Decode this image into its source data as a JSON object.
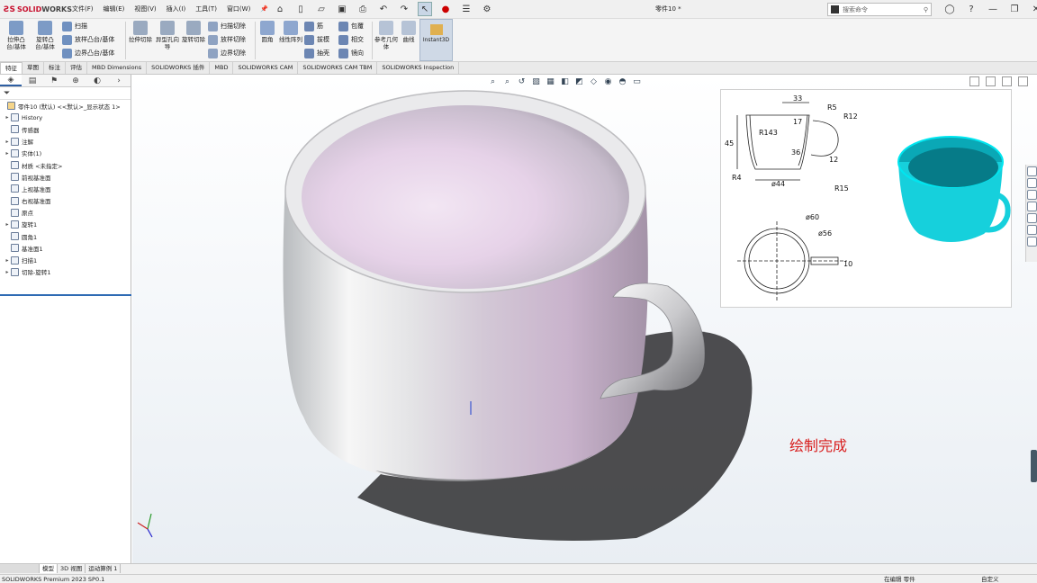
{
  "app": {
    "brand_prefix": "SOLID",
    "brand_suffix": "WORKS",
    "document_title": "零件10 *"
  },
  "menu": [
    "文件(F)",
    "编辑(E)",
    "视图(V)",
    "插入(I)",
    "工具(T)",
    "窗口(W)"
  ],
  "search": {
    "placeholder": "搜索命令"
  },
  "ribbon": {
    "big": [
      "拉伸凸台/基体",
      "旋转凸台/基体",
      "拉伸切除",
      "异型孔向导",
      "旋转切除",
      "圆角",
      "线性阵列",
      "参考几何体",
      "曲线",
      "Instant3D"
    ],
    "small": [
      "扫描",
      "放样凸台/基体",
      "边界凸台/基体",
      "扫描切除",
      "放样切除",
      "边界切除",
      "筋",
      "拔模",
      "抽壳",
      "包覆",
      "相交",
      "镜向"
    ]
  },
  "tabs": [
    "特征",
    "草图",
    "标注",
    "评估",
    "MBD Dimensions",
    "SOLIDWORKS 插件",
    "MBD",
    "SOLIDWORKS CAM",
    "SOLIDWORKS CAM TBM",
    "SOLIDWORKS Inspection"
  ],
  "tree": {
    "root": "零件10 (默认) <<默认>_显示状态 1>",
    "items": [
      "History",
      "传感器",
      "注解",
      "实体(1)",
      "材质 <未指定>",
      "前视基准面",
      "上视基准面",
      "右视基准面",
      "原点",
      "旋转1",
      "圆角1",
      "基准面1",
      "扫描1",
      "切除-旋转1"
    ]
  },
  "drawing": {
    "dims": [
      "33",
      "R5",
      "R12",
      "17",
      "R143",
      "45",
      "36",
      "12",
      "R4",
      "ø44",
      "R15",
      "ø60",
      "ø56",
      "10"
    ]
  },
  "viewport": {
    "annotation": "绘制完成"
  },
  "model_tabs": [
    "模型",
    "3D 视图",
    "运动算例 1"
  ],
  "status": {
    "left": "SOLIDWORKS Premium 2023 SP0.1",
    "middle": "在编辑 零件",
    "right": "自定义"
  }
}
